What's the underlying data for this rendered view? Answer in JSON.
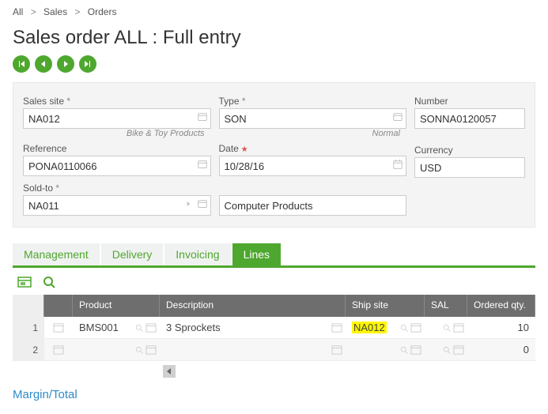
{
  "breadcrumb": [
    "All",
    "Sales",
    "Orders"
  ],
  "title": "Sales order ALL : Full entry",
  "form": {
    "sales_site": {
      "label": "Sales site",
      "value": "NA012",
      "sub": "Bike & Toy Products"
    },
    "type": {
      "label": "Type",
      "value": "SON",
      "sub": "Normal"
    },
    "number": {
      "label": "Number",
      "value": "SONNA0120057"
    },
    "reference": {
      "label": "Reference",
      "value": "PONA0110066"
    },
    "date": {
      "label": "Date",
      "value": "10/28/16"
    },
    "currency": {
      "label": "Currency",
      "value": "USD"
    },
    "sold_to": {
      "label": "Sold-to",
      "value": "NA011",
      "desc": "Computer Products"
    }
  },
  "tabs": [
    {
      "label": "Management",
      "active": false
    },
    {
      "label": "Delivery",
      "active": false
    },
    {
      "label": "Invoicing",
      "active": false
    },
    {
      "label": "Lines",
      "active": true
    }
  ],
  "grid": {
    "headers": {
      "product": "Product",
      "description": "Description",
      "ship_site": "Ship site",
      "sal": "SAL",
      "qty": "Ordered qty."
    },
    "rows": [
      {
        "n": "1",
        "product": "BMS001",
        "description": "3 Sprockets",
        "ship_site": "NA012",
        "qty": "10",
        "highlight_ship": true
      },
      {
        "n": "2",
        "product": "",
        "description": "",
        "ship_site": "",
        "qty": "0",
        "highlight_ship": false
      }
    ]
  },
  "footer": "Margin/Total"
}
